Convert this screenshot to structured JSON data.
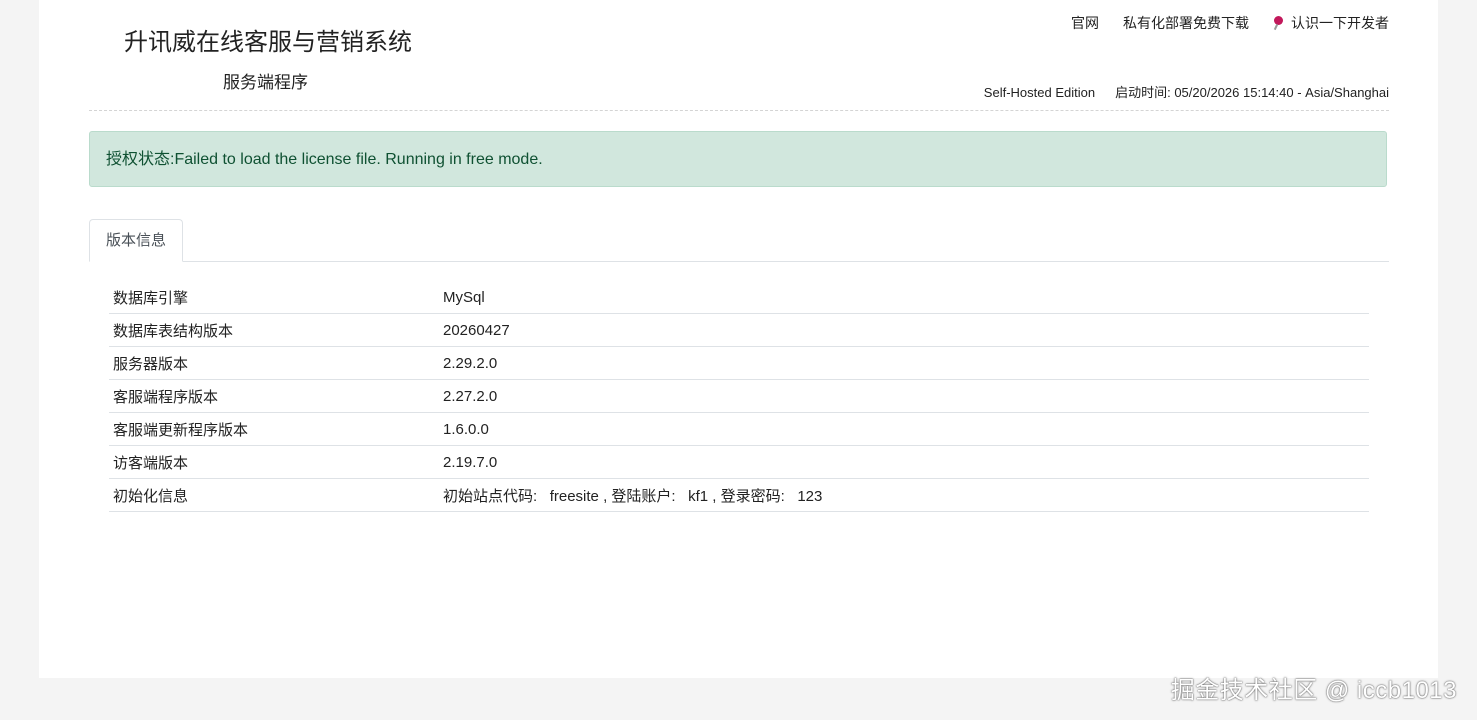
{
  "header": {
    "title": "升讯威在线客服与营销系统",
    "subtitle": "服务端程序",
    "nav": {
      "official_site": "官网",
      "private_download": "私有化部署免费下载",
      "meet_developer": "认识一下开发者"
    },
    "edition": "Self-Hosted Edition",
    "start_time_label": "启动时间:",
    "start_time_value": "05/20/2026 15:14:40 - Asia/Shanghai"
  },
  "alert": {
    "text": "授权状态:Failed to load the license file. Running in free mode."
  },
  "tabs": [
    {
      "label": "版本信息"
    }
  ],
  "info_rows": [
    {
      "key": "数据库引擎",
      "value": "MySql"
    },
    {
      "key": "数据库表结构版本",
      "value": "20260427"
    },
    {
      "key": "服务器版本",
      "value": "2.29.2.0"
    },
    {
      "key": "客服端程序版本",
      "value": "2.27.2.0"
    },
    {
      "key": "客服端更新程序版本",
      "value": "1.6.0.0"
    },
    {
      "key": "访客端版本",
      "value": "2.19.7.0"
    }
  ],
  "init_info": {
    "key": "初始化信息",
    "site_code_label": "初始站点代码:",
    "site_code_value": "freesite",
    "account_label": ", 登陆账户:",
    "account_value": "kf1",
    "password_label": ", 登录密码:",
    "password_value": "123"
  },
  "watermark": "掘金技术社区 @ iccb1013",
  "colors": {
    "alert_bg": "#d1e7dd",
    "alert_text": "#0f5132",
    "pin": "#c2185b"
  }
}
